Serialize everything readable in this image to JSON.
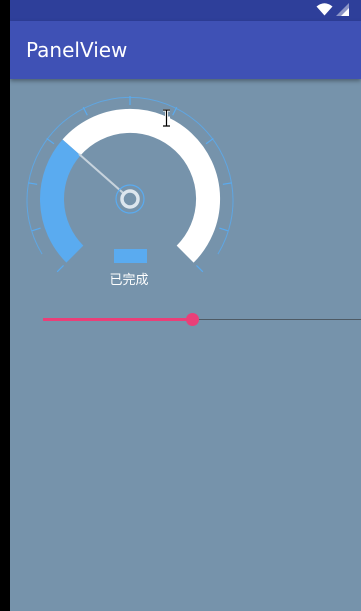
{
  "status_bar": {
    "icons": [
      "wifi-icon",
      "cell-signal-icon"
    ],
    "color": "#2e3f9a"
  },
  "app_bar": {
    "title": "PanelView",
    "color": "#3f51b5"
  },
  "content": {
    "background": "#7693ab"
  },
  "gauge": {
    "progress_fraction": 0.32,
    "filled_color": "#5aabf0",
    "remaining_color": "#ffffff",
    "status_text": "已完成"
  },
  "seekbar": {
    "progress_fraction": 0.47,
    "accent_color": "#ea3f78"
  },
  "pointer": {
    "icon": "text-cursor-icon"
  }
}
